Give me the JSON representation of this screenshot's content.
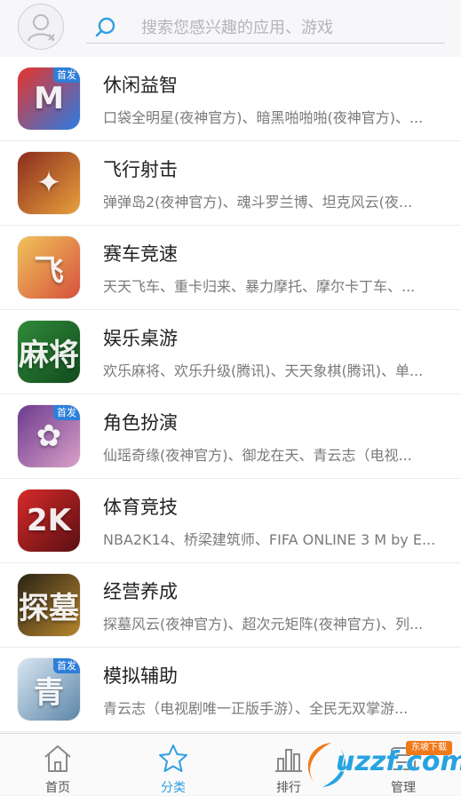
{
  "header": {
    "search_placeholder": "搜索您感兴趣的应用、游戏"
  },
  "categories": [
    {
      "title": "休闲益智",
      "desc": "口袋全明星(夜神官方)、暗黑啪啪啪(夜神官方)、...",
      "badge": "首发",
      "icon": "mario-game-icon",
      "colors": [
        "#e7342b",
        "#2b7be4"
      ],
      "glyph": "M"
    },
    {
      "title": "飞行射击",
      "desc": "弹弹岛2(夜神官方)、魂斗罗兰博、坦克风云(夜...",
      "badge": "",
      "icon": "bomb-hero-game-icon",
      "colors": [
        "#8a2c1e",
        "#e8a13c"
      ],
      "glyph": "✦"
    },
    {
      "title": "赛车竞速",
      "desc": "天天飞车、重卡归来、暴力摩托、摩尔卡丁车、...",
      "badge": "",
      "icon": "racing-girl-game-icon",
      "colors": [
        "#f0c35a",
        "#d6513d"
      ],
      "glyph": "飞"
    },
    {
      "title": "娱乐桌游",
      "desc": "欢乐麻将、欢乐升级(腾讯)、天天象棋(腾讯)、单...",
      "badge": "",
      "icon": "mahjong-game-icon",
      "colors": [
        "#2f8a3a",
        "#114b1c"
      ],
      "glyph": "麻将"
    },
    {
      "title": "角色扮演",
      "desc": "仙瑶奇缘(夜神官方)、御龙在天、青云志（电视...",
      "badge": "首发",
      "icon": "fantasy-lady-game-icon",
      "colors": [
        "#6c3a8e",
        "#d9a1c7"
      ],
      "glyph": "✿"
    },
    {
      "title": "体育竞技",
      "desc": "NBA2K14、桥梁建筑师、FIFA ONLINE 3 M by E...",
      "badge": "",
      "icon": "nba-2k14-game-icon",
      "colors": [
        "#d72a2a",
        "#5a0f12"
      ],
      "glyph": "2K"
    },
    {
      "title": "经营养成",
      "desc": "探墓风云(夜神官方)、超次元矩阵(夜神官方)、列...",
      "badge": "",
      "icon": "tomb-explorer-game-icon",
      "colors": [
        "#2a2216",
        "#b8862d"
      ],
      "glyph": "探墓"
    },
    {
      "title": "模拟辅助",
      "desc": "青云志（电视剧唯一正版手游）、全民无双掌游...",
      "badge": "首发",
      "icon": "swordsman-game-icon",
      "colors": [
        "#d8e6f2",
        "#5d86a8"
      ],
      "glyph": "青"
    }
  ],
  "tabs": [
    {
      "label": "首页",
      "icon": "home-icon",
      "active": false
    },
    {
      "label": "分类",
      "icon": "star-icon",
      "active": true
    },
    {
      "label": "排行",
      "icon": "ranking-chart-icon",
      "active": false
    },
    {
      "label": "管理",
      "icon": "manage-icon",
      "active": false
    }
  ],
  "watermark": {
    "text": "uzzf.com",
    "chip": "东坡下载"
  },
  "colors": {
    "accent": "#2f9fe0",
    "badge": "#2e7fd9",
    "tab_inactive": "#555555"
  }
}
